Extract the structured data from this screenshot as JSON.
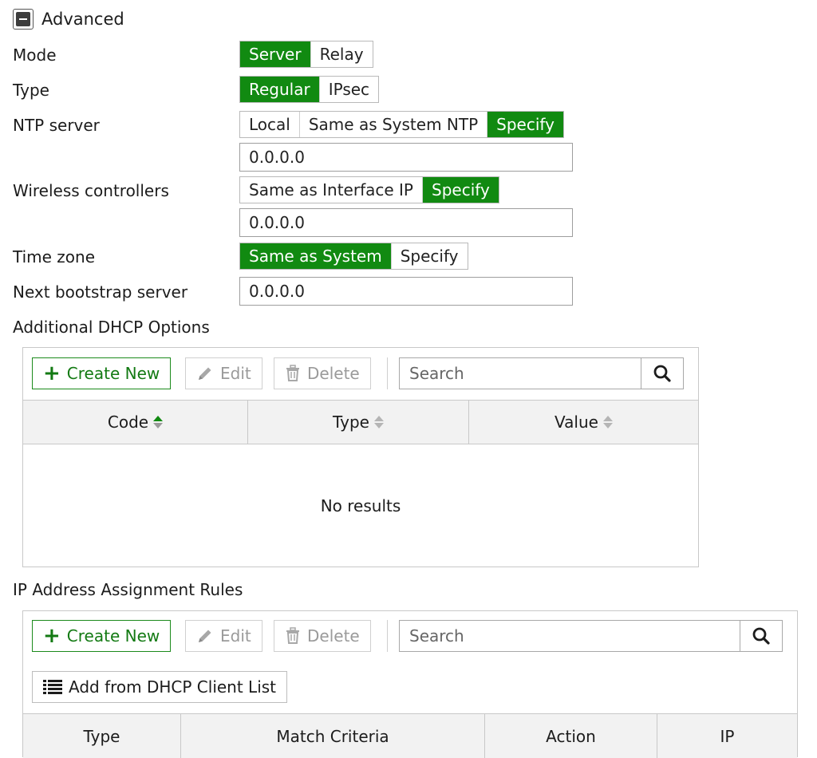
{
  "advanced": {
    "title": "Advanced",
    "mode": {
      "label": "Mode",
      "options": [
        "Server",
        "Relay"
      ],
      "selected": "Server"
    },
    "type": {
      "label": "Type",
      "options": [
        "Regular",
        "IPsec"
      ],
      "selected": "Regular"
    },
    "ntp_server": {
      "label": "NTP server",
      "options": [
        "Local",
        "Same as System NTP",
        "Specify"
      ],
      "selected": "Specify",
      "value": "0.0.0.0"
    },
    "wireless_controllers": {
      "label": "Wireless controllers",
      "options": [
        "Same as Interface IP",
        "Specify"
      ],
      "selected": "Specify",
      "value": "0.0.0.0"
    },
    "time_zone": {
      "label": "Time zone",
      "options": [
        "Same as System",
        "Specify"
      ],
      "selected": "Same as System"
    },
    "next_bootstrap": {
      "label": "Next bootstrap server",
      "value": "0.0.0.0"
    }
  },
  "dhcp_options": {
    "title": "Additional DHCP Options",
    "toolbar": {
      "create": "Create New",
      "edit": "Edit",
      "delete": "Delete",
      "search_placeholder": "Search"
    },
    "columns": [
      "Code",
      "Type",
      "Value"
    ],
    "empty_text": "No results"
  },
  "ip_rules": {
    "title": "IP Address Assignment Rules",
    "toolbar": {
      "create": "Create New",
      "edit": "Edit",
      "delete": "Delete",
      "search_placeholder": "Search",
      "add_from_list": "Add from DHCP Client List"
    },
    "columns": [
      "Type",
      "Match Criteria",
      "Action",
      "IP"
    ]
  },
  "colors": {
    "accent": "#118a11",
    "border": "#c8c8c8",
    "header_bg": "#f2f2f2"
  }
}
